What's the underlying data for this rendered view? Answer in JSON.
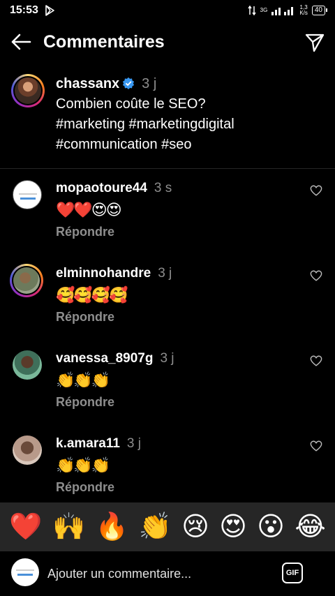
{
  "status_bar": {
    "time": "15:53",
    "network": "3G",
    "speed_value": "1,3",
    "speed_unit": "K/s",
    "battery": "40"
  },
  "header": {
    "title": "Commentaires"
  },
  "caption": {
    "username": "chassanx",
    "time": "3 j",
    "text_line1": "Combien coûte le SEO?",
    "text_line2": "#marketing #marketingdigital",
    "text_line3": "#communication #seo"
  },
  "comments": [
    {
      "username": "mopaotoure44",
      "time": "3 s",
      "text": "❤️❤️😍😍",
      "reply_label": "Répondre"
    },
    {
      "username": "elminnohandre",
      "time": "3 j",
      "text": "🥰🥰🥰🥰",
      "reply_label": "Répondre"
    },
    {
      "username": "vanessa_8907g",
      "time": "3 j",
      "text": "👏👏👏",
      "reply_label": "Répondre"
    },
    {
      "username": "k.amara11",
      "time": "3 j",
      "text": "👏👏👏",
      "reply_label": "Répondre"
    }
  ],
  "emoji_bar": [
    "❤️",
    "🙌",
    "🔥",
    "👏",
    "😢",
    "😍",
    "😮",
    "😂"
  ],
  "input": {
    "placeholder": "Ajouter un commentaire...",
    "gif_label": "GIF"
  },
  "icons": {
    "back": "arrow-left-icon",
    "send": "paper-plane-icon",
    "like": "heart-outline-icon",
    "verified": "verified-badge-icon"
  },
  "colors": {
    "background": "#000000",
    "muted_text": "#8e8e8e",
    "verified_blue": "#3897f0",
    "emoji_bar_bg": "#262626"
  }
}
